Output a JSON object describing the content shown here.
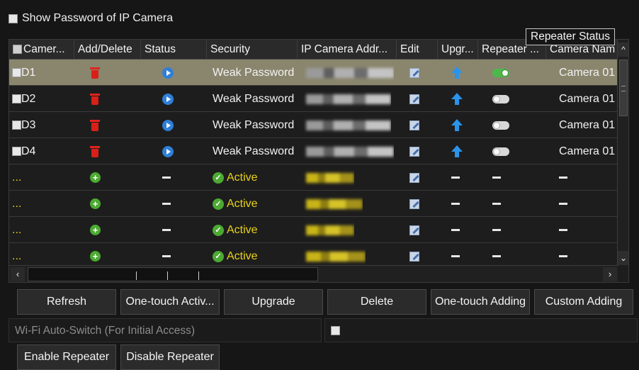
{
  "show_password": {
    "label": "Show Password of IP Camera",
    "checked": false
  },
  "tooltip": "Repeater Status",
  "table": {
    "headers": [
      "Camer...",
      "Add/Delete",
      "Status",
      "Security",
      "IP Camera Addr...",
      "Edit",
      "Upgr...",
      "Repeater ...",
      "Camera Nam"
    ],
    "rows": [
      {
        "camera": "D1",
        "add_delete": "delete-icon",
        "status": "play-icon",
        "security": "Weak Password",
        "ip": "blurred",
        "edit": "edit-icon",
        "upgrade": "upgrade-icon",
        "repeater": "on",
        "name": "Camera 01",
        "selected": true
      },
      {
        "camera": "D2",
        "add_delete": "delete-icon",
        "status": "play-icon",
        "security": "Weak Password",
        "ip": "blurred",
        "edit": "edit-icon",
        "upgrade": "upgrade-icon",
        "repeater": "off",
        "name": "Camera 01",
        "selected": false
      },
      {
        "camera": "D3",
        "add_delete": "delete-icon",
        "status": "play-icon",
        "security": "Weak Password",
        "ip": "blurred",
        "edit": "edit-icon",
        "upgrade": "upgrade-icon",
        "repeater": "off",
        "name": "Camera 01",
        "selected": false
      },
      {
        "camera": "D4",
        "add_delete": "delete-icon",
        "status": "play-icon",
        "security": "Weak Password",
        "ip": "blurred",
        "edit": "edit-icon",
        "upgrade": "upgrade-icon",
        "repeater": "off",
        "name": "Camera 01",
        "selected": false
      },
      {
        "camera": "...",
        "add_delete": "add-icon",
        "status": "—",
        "security": "Active",
        "ip": "blurred",
        "edit": "edit-icon",
        "upgrade": "—",
        "repeater": "—",
        "name": "—",
        "selected": false
      },
      {
        "camera": "...",
        "add_delete": "add-icon",
        "status": "—",
        "security": "Active",
        "ip": "blurred",
        "edit": "edit-icon",
        "upgrade": "—",
        "repeater": "—",
        "name": "—",
        "selected": false
      },
      {
        "camera": "...",
        "add_delete": "add-icon",
        "status": "—",
        "security": "Active",
        "ip": "blurred",
        "edit": "edit-icon",
        "upgrade": "—",
        "repeater": "—",
        "name": "—",
        "selected": false
      },
      {
        "camera": "...",
        "add_delete": "add-icon",
        "status": "—",
        "security": "Active",
        "ip": "blurred",
        "edit": "edit-icon",
        "upgrade": "—",
        "repeater": "—",
        "name": "—",
        "selected": false
      }
    ]
  },
  "buttons": {
    "refresh": "Refresh",
    "one_touch_activate": "One-touch Activ...",
    "upgrade": "Upgrade",
    "delete": "Delete",
    "one_touch_adding": "One-touch Adding",
    "custom_adding": "Custom Adding",
    "enable_repeater": "Enable Repeater",
    "disable_repeater": "Disable Repeater"
  },
  "wifi_auto_switch": {
    "label": "Wi-Fi Auto-Switch (For Initial Access)",
    "checked": false
  },
  "colors": {
    "background": "#161616",
    "selected_row": "#8a866e",
    "active_text": "#e9d21a",
    "delete_red": "#d82018",
    "add_green": "#4caa32",
    "status_blue": "#2e7fd8",
    "toggle_on": "#4cb84a"
  }
}
